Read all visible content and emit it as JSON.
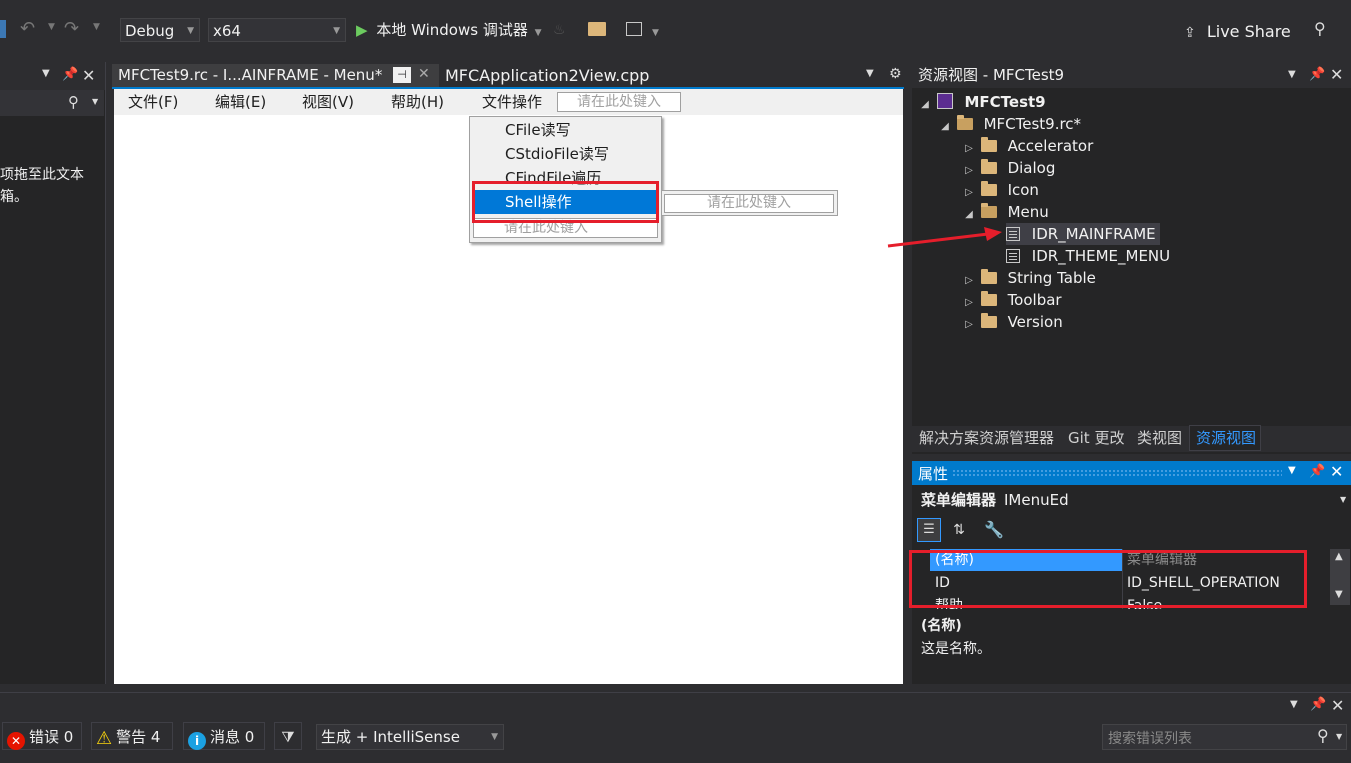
{
  "toolbar": {
    "config": "Debug",
    "platform": "x64",
    "run_label": "本地 Windows 调试器",
    "live_share": "Live Share"
  },
  "left_panel": {
    "hint_line1": "项拖至此文本",
    "hint_line2": "箱。"
  },
  "editor": {
    "tabs": [
      {
        "label": "MFCTest9.rc - I...AINFRAME - Menu*",
        "active": true
      },
      {
        "label": "MFCApplication2View.cpp",
        "active": false
      }
    ],
    "menubar": [
      "文件(F)",
      "编辑(E)",
      "视图(V)",
      "帮助(H)",
      "文件操作"
    ],
    "menubar_placeholder": "请在此处键入",
    "dropdown_items": [
      "CFile读写",
      "CStdioFile读写",
      "CFindFile遍历",
      "Shell操作"
    ],
    "dropdown_placeholder": "请在此处键入",
    "submenu_placeholder": "请在此处键入"
  },
  "resource_view": {
    "title": "资源视图 - MFCTest9",
    "root": "MFCTest9",
    "rc_file": "MFCTest9.rc*",
    "folders": [
      "Accelerator",
      "Dialog",
      "Icon",
      "Menu"
    ],
    "menu_children": [
      "IDR_MAINFRAME",
      "IDR_THEME_MENU"
    ],
    "folders_after": [
      "String Table",
      "Toolbar",
      "Version"
    ],
    "bottom_tabs": [
      "解决方案资源管理器",
      "Git 更改",
      "类视图",
      "资源视图"
    ]
  },
  "properties": {
    "title": "属性",
    "object_name": "菜单编辑器",
    "object_type": "IMenuEd",
    "rows": [
      {
        "name": "(名称)",
        "value": "菜单编辑器"
      },
      {
        "name": "ID",
        "value": "ID_SHELL_OPERATION"
      },
      {
        "name": "帮助",
        "value": "False"
      }
    ],
    "desc_title": "(名称)",
    "desc_text": "这是名称。"
  },
  "error_list": {
    "errors": "错误 0",
    "warnings": "警告 4",
    "messages": "消息 0",
    "source": "生成 + IntelliSense",
    "search_placeholder": "搜索错误列表"
  },
  "colors": {
    "accent": "#007acc",
    "highlight_box": "#e51e2b",
    "arrow": "#e51e2b",
    "bg": "#2d2d30",
    "selection": "#3399ff"
  }
}
